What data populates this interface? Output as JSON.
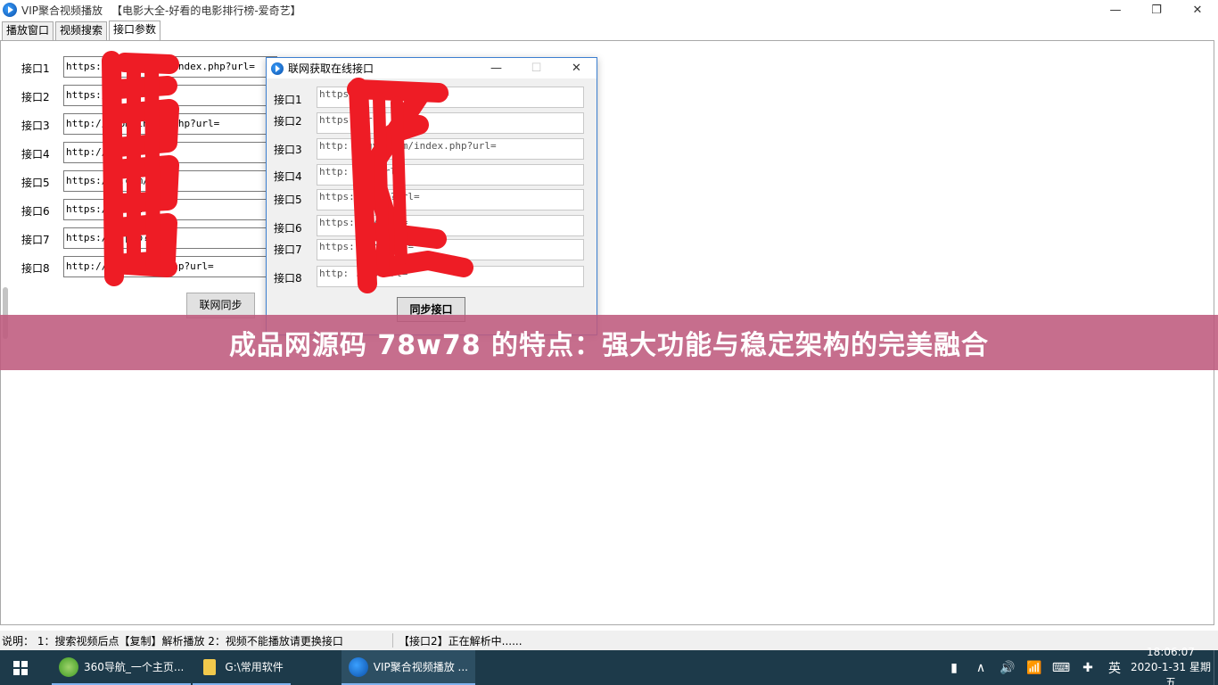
{
  "window": {
    "title": "VIP聚合视频播放",
    "subtitle": "【电影大全-好看的电影排行榜-爱奇艺】",
    "minimize": "—",
    "restore": "❐",
    "close": "✕"
  },
  "tabs": [
    {
      "label": "播放窗口"
    },
    {
      "label": "视频搜索"
    },
    {
      "label": "接口参数"
    }
  ],
  "main": {
    "rows": [
      {
        "label": "接口1",
        "value": "https://      .com/api/index.php?url="
      },
      {
        "label": "接口2",
        "value": "https://       url="
      },
      {
        "label": "接口3",
        "value": "http://        com/index.php?url="
      },
      {
        "label": "接口4",
        "value": "http://         ?url="
      },
      {
        "label": "接口5",
        "value": "https://       .com/?url="
      },
      {
        "label": "接口6",
        "value": "https://       ?url="
      },
      {
        "label": "接口7",
        "value": "https://       .php?url="
      },
      {
        "label": "接口8",
        "value": "http://        om/video.php?url="
      }
    ],
    "sync_button": "联网同步"
  },
  "dialog": {
    "title": "联网获取在线接口",
    "minimize": "—",
    "maximize": "☐",
    "close": "✕",
    "rows": [
      {
        "label": "接口1",
        "value": "https:            /index.php?url="
      },
      {
        "label": "接口2",
        "value": "https:            url="
      },
      {
        "label": "接口3",
        "value": "http:       ingys.com/index.php?url="
      },
      {
        "label": "接口4",
        "value": "http:            om/?url="
      },
      {
        "label": "接口5",
        "value": "https:           .com/?url="
      },
      {
        "label": "接口6",
        "value": "https:          om/?url="
      },
      {
        "label": "接口7",
        "value": "https:            .php?url="
      },
      {
        "label": "接口8",
        "value": "http:               .php?url="
      }
    ],
    "sync_button": "同步接口"
  },
  "banner": {
    "text": "成品网源码 78w78 的特点：强大功能与稳定架构的完美融合"
  },
  "statusbar": {
    "left": "说明： 1：搜索视频后点【复制】解析播放 2：视频不能播放请更换接口",
    "right": "【接口2】正在解析中......"
  },
  "taskbar": {
    "tasks": [
      {
        "label": "360导航_一个主页..."
      },
      {
        "label": "G:\\常用软件"
      },
      {
        "label": "VIP聚合视频播放 ..."
      }
    ],
    "tray": {
      "battery": "▮",
      "chevron": "∧",
      "volume": "🔊",
      "network": "📶",
      "keyboard": "⌨",
      "security": "✚",
      "ime": "英"
    },
    "time": "18:06:07",
    "date": "2020-1-31 星期五"
  }
}
